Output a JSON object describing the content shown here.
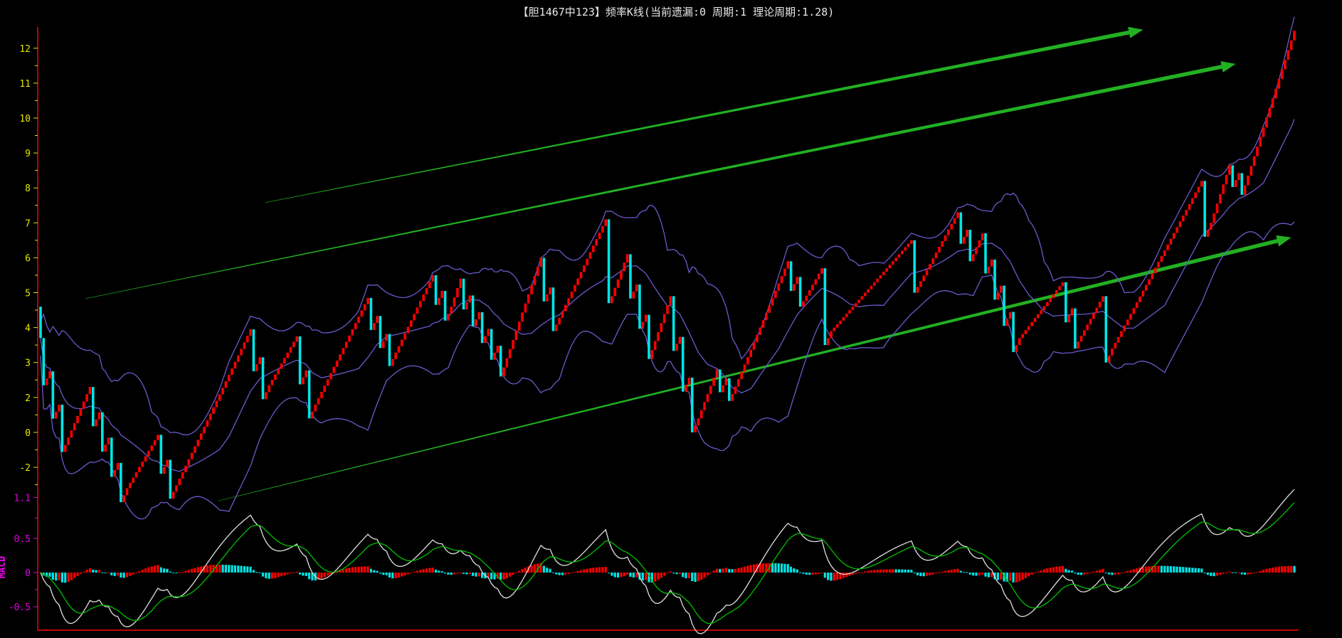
{
  "title": "【胆1467中123】频率K线(当前遗漏:0 周期:1 理论周期:1.28)",
  "chart_data": {
    "type": "bar",
    "title": "【胆1467中123】频率K线(当前遗漏:0 周期:1 理论周期:1.28)",
    "main_panel": {
      "y_tick_labels": [
        "12",
        "11",
        "10",
        "9",
        "8",
        "7",
        "6",
        "5",
        "4",
        "3",
        "2",
        "0",
        "-2"
      ],
      "y_tick_positions": [
        12,
        11,
        10,
        9,
        8,
        7,
        6,
        5,
        4,
        3,
        2,
        1,
        0
      ],
      "ylim": [
        -0.3,
        12.7
      ],
      "up_color": "#ff0000",
      "down_color": "#00e5e5",
      "band_color": "#6a5acd",
      "close_waypoints": [
        [
          0,
          3.7
        ],
        [
          8,
          0.64
        ],
        [
          16,
          2.3
        ],
        [
          28,
          -0.6
        ],
        [
          38,
          0.93
        ],
        [
          43,
          -0.7
        ],
        [
          68,
          3.95
        ],
        [
          74,
          2.35
        ],
        [
          83,
          3.75
        ],
        [
          89,
          1.8
        ],
        [
          106,
          4.85
        ],
        [
          114,
          3.1
        ],
        [
          127,
          5.5
        ],
        [
          133,
          4.6
        ],
        [
          136,
          5.4
        ],
        [
          149,
          2.6
        ],
        [
          162,
          6.0
        ],
        [
          166,
          3.9
        ],
        [
          183,
          7.1
        ],
        [
          185,
          4.9
        ],
        [
          190,
          6.1
        ],
        [
          197,
          3.1
        ],
        [
          204,
          4.9
        ],
        [
          213,
          1.4
        ],
        [
          219,
          2.8
        ],
        [
          224,
          2.1
        ],
        [
          242,
          5.9
        ],
        [
          246,
          4.6
        ],
        [
          253,
          5.7
        ],
        [
          256,
          3.9
        ],
        [
          282,
          6.5
        ],
        [
          283,
          5.0
        ],
        [
          297,
          7.3
        ],
        [
          303,
          6.3
        ],
        [
          305,
          6.7
        ],
        [
          317,
          3.7
        ],
        [
          331,
          5.3
        ],
        [
          336,
          3.6
        ],
        [
          344,
          4.9
        ],
        [
          347,
          3.4
        ],
        [
          376,
          8.2
        ],
        [
          379,
          7.0
        ],
        [
          385,
          8.65
        ],
        [
          389,
          7.8
        ],
        [
          406,
          12.5
        ]
      ],
      "bollinger": {
        "period": 20,
        "width": 2
      },
      "trendlines": [
        {
          "from": [
            72.8,
            7.58
          ],
          "to": [
            357,
            12.53
          ]
        },
        {
          "from": [
            14.5,
            4.83
          ],
          "to": [
            387,
            11.55
          ]
        },
        {
          "from": [
            57.6,
            -0.96
          ],
          "to": [
            405,
            6.58
          ]
        }
      ],
      "trendline_color": "#22b022"
    },
    "macd_panel": {
      "label": "MACD",
      "y_tick_labels": [
        "1.1",
        "0.5",
        "0",
        "-0.5"
      ],
      "y_tick_values": [
        1.1,
        0.5,
        0,
        -0.5
      ],
      "fast": 12,
      "slow": 26,
      "signal": 9,
      "dif_color": "#e0e0e0",
      "dea_color": "#00c000"
    }
  }
}
